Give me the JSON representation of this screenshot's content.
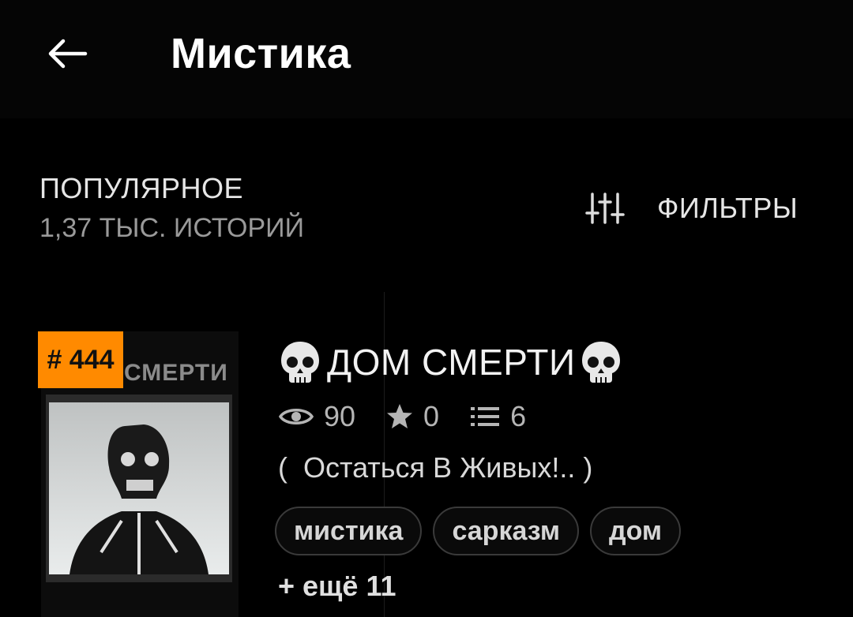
{
  "appbar": {
    "title": "Мистика",
    "back_icon": "arrow-left-icon"
  },
  "section": {
    "title": "ПОПУЛЯРНОЕ",
    "subtitle": "1,37 ТЫС. ИСТОРИЙ",
    "filters_label": "ФИЛЬТРЫ",
    "filters_icon": "sliders-icon"
  },
  "story": {
    "rank": "# 444",
    "cover_title": "СМЕРТИ",
    "title": "ДОМ СМЕРТИ",
    "title_emoji": "skull-icon",
    "stats": {
      "views": "90",
      "votes": "0",
      "parts": "6"
    },
    "description": "(  Остаться В Живых!.. )",
    "tags": [
      "мистика",
      "сарказм",
      "дом"
    ],
    "more_tags": "+ ещё 11"
  },
  "colors": {
    "background": "#000000",
    "badge": "#ff8a00",
    "text_primary": "#f2f2f2",
    "text_secondary": "#9a9a9a"
  }
}
